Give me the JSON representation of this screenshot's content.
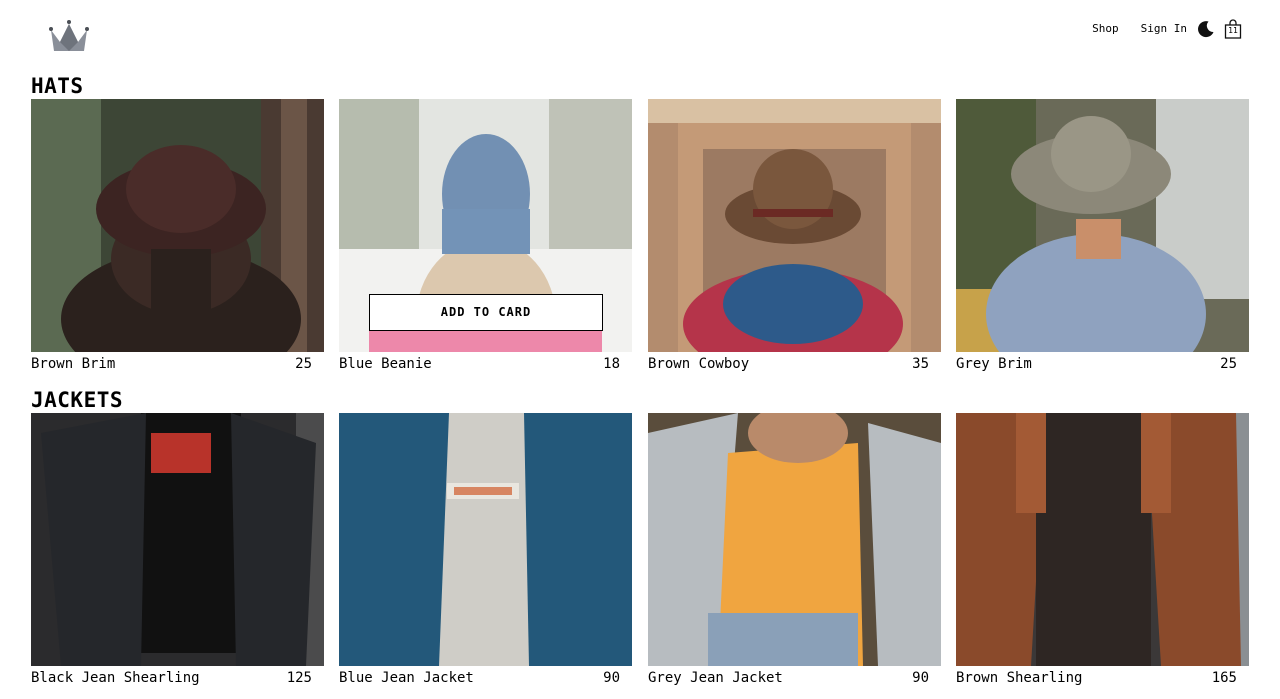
{
  "nav": {
    "logo_icon": "crown-icon",
    "links": [
      "Shop",
      "Sign In"
    ],
    "theme_icon": "moon-icon",
    "cart_icon": "shopping-bag-icon",
    "cart_count": "11"
  },
  "sections": [
    {
      "title": "HATS",
      "items": [
        {
          "name": "Brown Brim",
          "price": "25"
        },
        {
          "name": "Blue Beanie",
          "price": "18"
        },
        {
          "name": "Brown Cowboy",
          "price": "35"
        },
        {
          "name": "Grey Brim",
          "price": "25"
        }
      ]
    },
    {
      "title": "JACKETS",
      "items": [
        {
          "name": "Black Jean Shearling",
          "price": "125"
        },
        {
          "name": "Blue Jean Jacket",
          "price": "90"
        },
        {
          "name": "Grey Jean Jacket",
          "price": "90"
        },
        {
          "name": "Brown Shearling",
          "price": "165"
        }
      ]
    }
  ],
  "hover_button_label": "ADD TO CARD"
}
